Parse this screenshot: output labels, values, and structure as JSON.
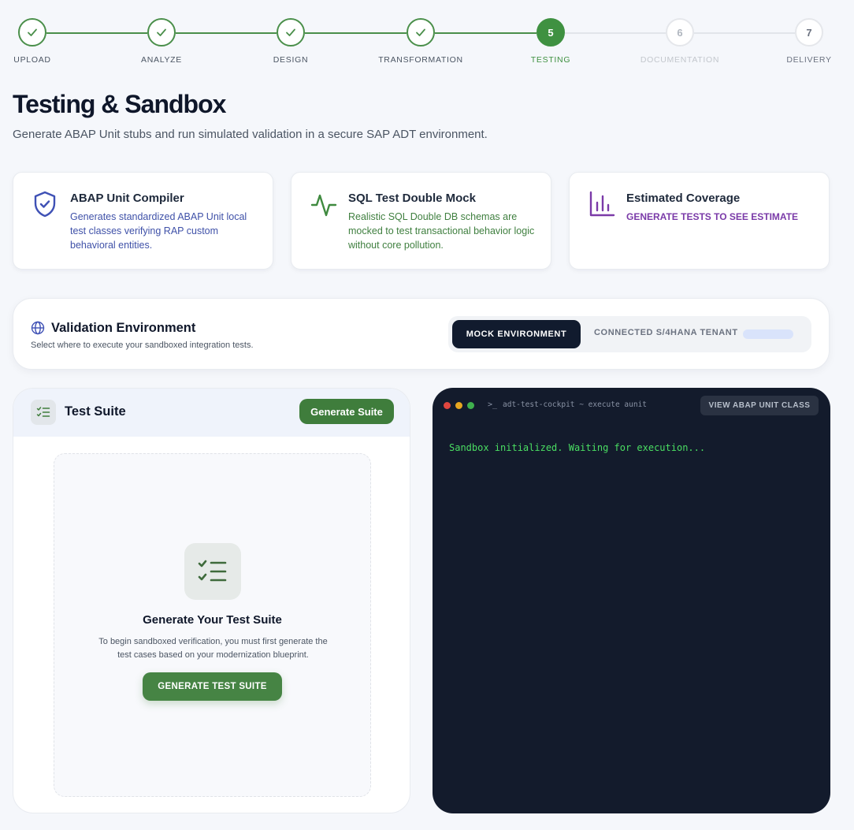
{
  "stepper": {
    "steps": [
      {
        "label": "UPLOAD",
        "state": "done"
      },
      {
        "label": "ANALYZE",
        "state": "done"
      },
      {
        "label": "DESIGN",
        "state": "done"
      },
      {
        "label": "TRANSFORMATION",
        "state": "done"
      },
      {
        "label": "TESTING",
        "number": "5",
        "state": "current"
      },
      {
        "label": "DOCUMENTATION",
        "number": "6",
        "state": "todo"
      },
      {
        "label": "DELIVERY",
        "number": "7",
        "state": "todo"
      }
    ]
  },
  "header": {
    "title": "Testing & Sandbox",
    "subtitle": "Generate ABAP Unit stubs and run simulated validation in a secure SAP ADT environment."
  },
  "cards": [
    {
      "title": "ABAP Unit Compiler",
      "description": "Generates standardized ABAP Unit local test classes verifying RAP custom behavioral entities.",
      "icon": "shield-check-icon",
      "color": "#3f51a8"
    },
    {
      "title": "SQL Test Double Mock",
      "description": "Realistic SQL Double DB schemas are mocked to test transactional behavior logic without core pollution.",
      "icon": "activity-icon",
      "color": "#3f7f3f"
    },
    {
      "title": "Estimated Coverage",
      "description": "GENERATE TESTS TO SEE ESTIMATE",
      "icon": "bar-chart-icon",
      "color": "#7a3aa8"
    }
  ],
  "environment": {
    "title": "Validation Environment",
    "subtitle": "Select where to execute your sandboxed integration tests.",
    "options": [
      "MOCK ENVIRONMENT",
      "CONNECTED S/4HANA TENANT"
    ],
    "selected": "MOCK ENVIRONMENT"
  },
  "test_suite": {
    "title": "Test Suite",
    "generate_button": "Generate Suite",
    "empty_title": "Generate Your Test Suite",
    "empty_description": "To begin sandboxed verification, you must first generate the test cases based on your modernization blueprint.",
    "empty_button": "GENERATE TEST SUITE"
  },
  "terminal": {
    "prompt": ">_",
    "title": "adt-test-cockpit ~ execute aunit",
    "view_button": "VIEW ABAP UNIT CLASS",
    "output": "Sandbox initialized. Waiting for execution..."
  },
  "colors": {
    "accent_green": "#3f9141",
    "terminal_bg": "#131b2c",
    "terminal_text": "#4ade62"
  }
}
